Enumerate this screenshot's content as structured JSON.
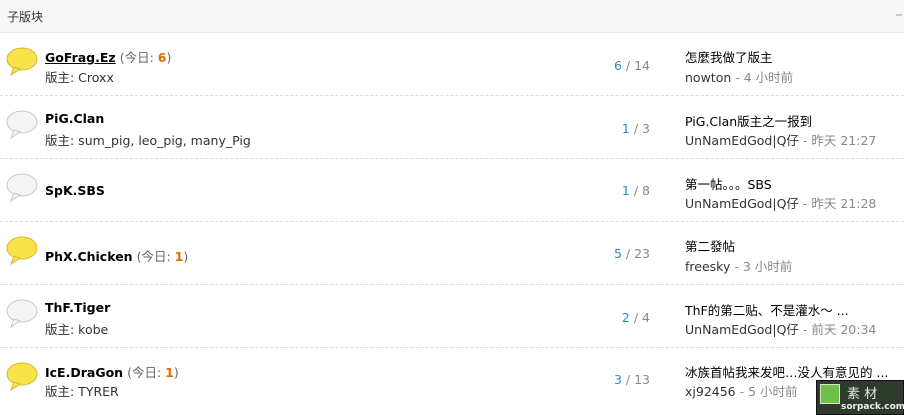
{
  "header": {
    "title": "子版块"
  },
  "forums": [
    {
      "name": "GoFrag.Ez",
      "underline": true,
      "today_prefix": "(今日: ",
      "today_count": "6",
      "today_suffix": ")",
      "moderators": "版主: Croxx",
      "topics": "6",
      "sep": " / ",
      "posts": "14",
      "last_title": "怎麼我做了版主",
      "last_user": "nowton",
      "last_time": " - 4 小时前",
      "icon": "new-posts-bubble-icon"
    },
    {
      "name": "PiG.Clan",
      "underline": false,
      "today_prefix": "",
      "today_count": "",
      "today_suffix": "",
      "moderators": "版主: sum_pig, leo_pig, many_Pig",
      "topics": "1",
      "sep": " / ",
      "posts": "3",
      "last_title": "PiG.Clan版主之一报到",
      "last_user": "UnNamEdGod|Q仔",
      "last_time": " - 昨天 21:27",
      "icon": "no-new-posts-bubble-icon"
    },
    {
      "name": "SpK.SBS",
      "underline": false,
      "today_prefix": "",
      "today_count": "",
      "today_suffix": "",
      "moderators": "",
      "topics": "1",
      "sep": " / ",
      "posts": "8",
      "last_title": "第一帖。。。SBS",
      "last_user": "UnNamEdGod|Q仔",
      "last_time": " - 昨天 21:28",
      "icon": "no-new-posts-bubble-icon"
    },
    {
      "name": "PhX.Chicken",
      "underline": false,
      "today_prefix": "(今日: ",
      "today_count": "1",
      "today_suffix": ")",
      "moderators": "",
      "topics": "5",
      "sep": " / ",
      "posts": "23",
      "last_title": "第二發帖",
      "last_user": "freesky",
      "last_time": " - 3 小时前",
      "icon": "new-posts-bubble-icon"
    },
    {
      "name": "ThF.Tiger",
      "underline": false,
      "today_prefix": "",
      "today_count": "",
      "today_suffix": "",
      "moderators": "版主: kobe",
      "topics": "2",
      "sep": " / ",
      "posts": "4",
      "last_title": "ThF的第二贴、不是灌水～ ...",
      "last_user": "UnNamEdGod|Q仔",
      "last_time": " - 前天 20:34",
      "icon": "no-new-posts-bubble-icon"
    },
    {
      "name": "IcE.DraGon",
      "underline": false,
      "today_prefix": "(今日: ",
      "today_count": "1",
      "today_suffix": ")",
      "moderators": "版主: TYRER",
      "topics": "3",
      "sep": " / ",
      "posts": "13",
      "last_title": "冰族首帖我来发吧…没人有意见的 ...",
      "last_user": "xj92456",
      "last_time": " - 5 小时前",
      "icon": "new-posts-bubble-icon"
    }
  ],
  "watermark": {
    "logo_text": "素 材",
    "site": "sorpack.com"
  },
  "colors": {
    "new_bubble": "#f9e34a",
    "old_bubble": "#f4f4f4",
    "today_count": "#e06d00",
    "topics": "#2a8bc2"
  }
}
